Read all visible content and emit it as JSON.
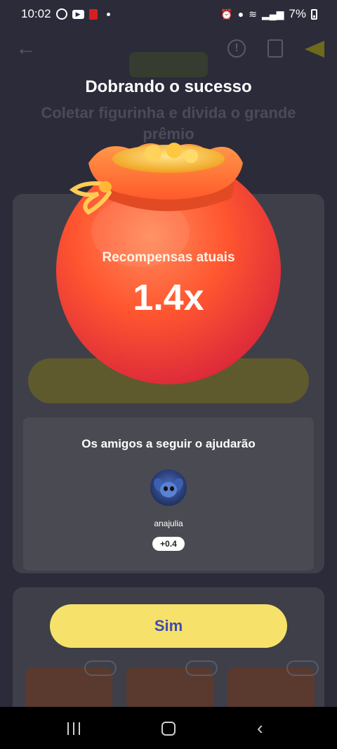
{
  "status_bar": {
    "time": "10:02",
    "battery": "7%"
  },
  "background": {
    "subtitle": "Coletar figurinha e divida o grande prêmio"
  },
  "overlay": {
    "title": "Dobrando o sucesso",
    "reward_label": "Recompensas atuais",
    "reward_value": "1.4x"
  },
  "friends_panel": {
    "title": "Os amigos a seguir o ajudarão",
    "friends": [
      {
        "name": "anajulia",
        "bonus": "+0.4"
      }
    ]
  },
  "confirm_button": {
    "label": "Sim"
  },
  "colors": {
    "backdrop": "#2b2b3a",
    "bag_orange": "#ff5a2a",
    "bag_red": "#e0283a",
    "button_yellow": "#f6e16a",
    "button_text": "#3f4bb4",
    "panel": "#4a4a52"
  }
}
